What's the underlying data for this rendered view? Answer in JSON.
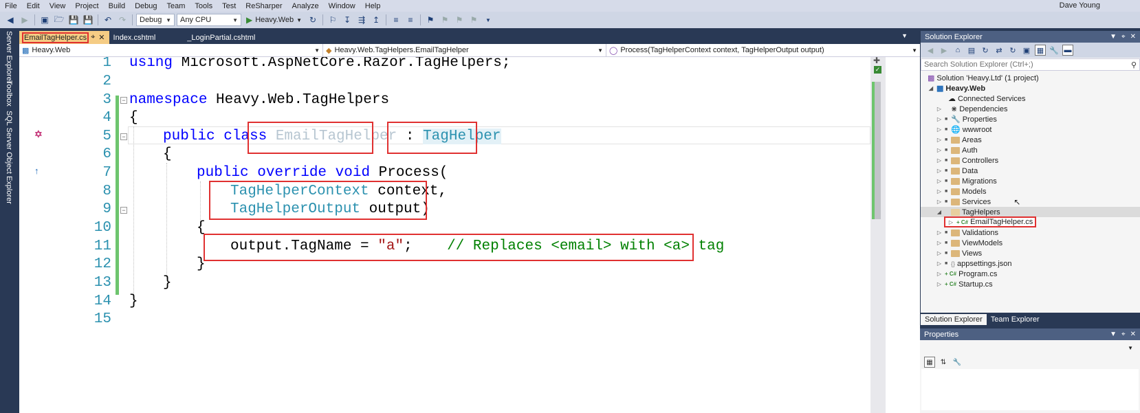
{
  "menu": [
    "File",
    "Edit",
    "View",
    "Project",
    "Build",
    "Debug",
    "Team",
    "Tools",
    "Test",
    "ReSharper",
    "Analyze",
    "Window",
    "Help"
  ],
  "user": "Dave Young",
  "toolbar": {
    "config": "Debug",
    "platform": "Any CPU",
    "start_target": "Heavy.Web"
  },
  "side_tabs": [
    "Server Explorer",
    "Toolbox",
    "SQL Server Object Explorer"
  ],
  "doc_tabs": [
    {
      "label": "EmailTagHelper.cs",
      "active": true
    },
    {
      "label": "Index.cshtml",
      "active": false
    },
    {
      "label": "_LoginPartial.cshtml",
      "active": false
    }
  ],
  "navbar": {
    "project": "Heavy.Web",
    "type": "Heavy.Web.TagHelpers.EmailTagHelper",
    "member": "Process(TagHelperContext context, TagHelperOutput output)"
  },
  "code": {
    "line_numbers": [
      "1",
      "2",
      "3",
      "4",
      "5",
      "6",
      "7",
      "8",
      "9",
      "10",
      "11",
      "12",
      "13",
      "14",
      "15"
    ],
    "l1_kw": "using",
    "l1_rest": " Microsoft.AspNetCore.Razor.TagHelpers;",
    "l3_kw": "namespace",
    "l3_rest": " Heavy.Web.TagHelpers",
    "l4": "{",
    "l5_kw": "public class ",
    "l5_name": "EmailTagHelper",
    "l5_colon": " : ",
    "l5_base": "TagHelper",
    "l6": "{",
    "l7_kw": "public override void",
    "l7_rest": " Process(",
    "l8_type": "TagHelperContext",
    "l8_rest": " context,",
    "l9_type": "TagHelperOutput",
    "l9_rest": " output)",
    "l10": "{",
    "l11_code": "output.TagName = ",
    "l11_str": "\"a\"",
    "l11_semi": ";",
    "l11_comment": "// Replaces <email> with <a> tag",
    "l12": "}",
    "l13": "}",
    "l14": "}"
  },
  "solution_explorer": {
    "title": "Solution Explorer",
    "search_placeholder": "Search Solution Explorer (Ctrl+;)",
    "solution": "Solution 'Heavy.Ltd' (1 project)",
    "project": "Heavy.Web",
    "items": [
      "Connected Services",
      "Dependencies",
      "Properties",
      "wwwroot",
      "Areas",
      "Auth",
      "Controllers",
      "Data",
      "Migrations",
      "Models",
      "Services",
      "TagHelpers",
      "EmailTagHelper.cs",
      "Validations",
      "ViewModels",
      "Views",
      "appsettings.json",
      "Program.cs",
      "Startup.cs"
    ],
    "tabs": [
      "Solution Explorer",
      "Team Explorer"
    ]
  },
  "properties": {
    "title": "Properties"
  },
  "colors": {
    "accent_red": "#e03030",
    "keyword": "#0000ff",
    "type": "#2b91af",
    "comment": "#008000",
    "string": "#a31515"
  }
}
